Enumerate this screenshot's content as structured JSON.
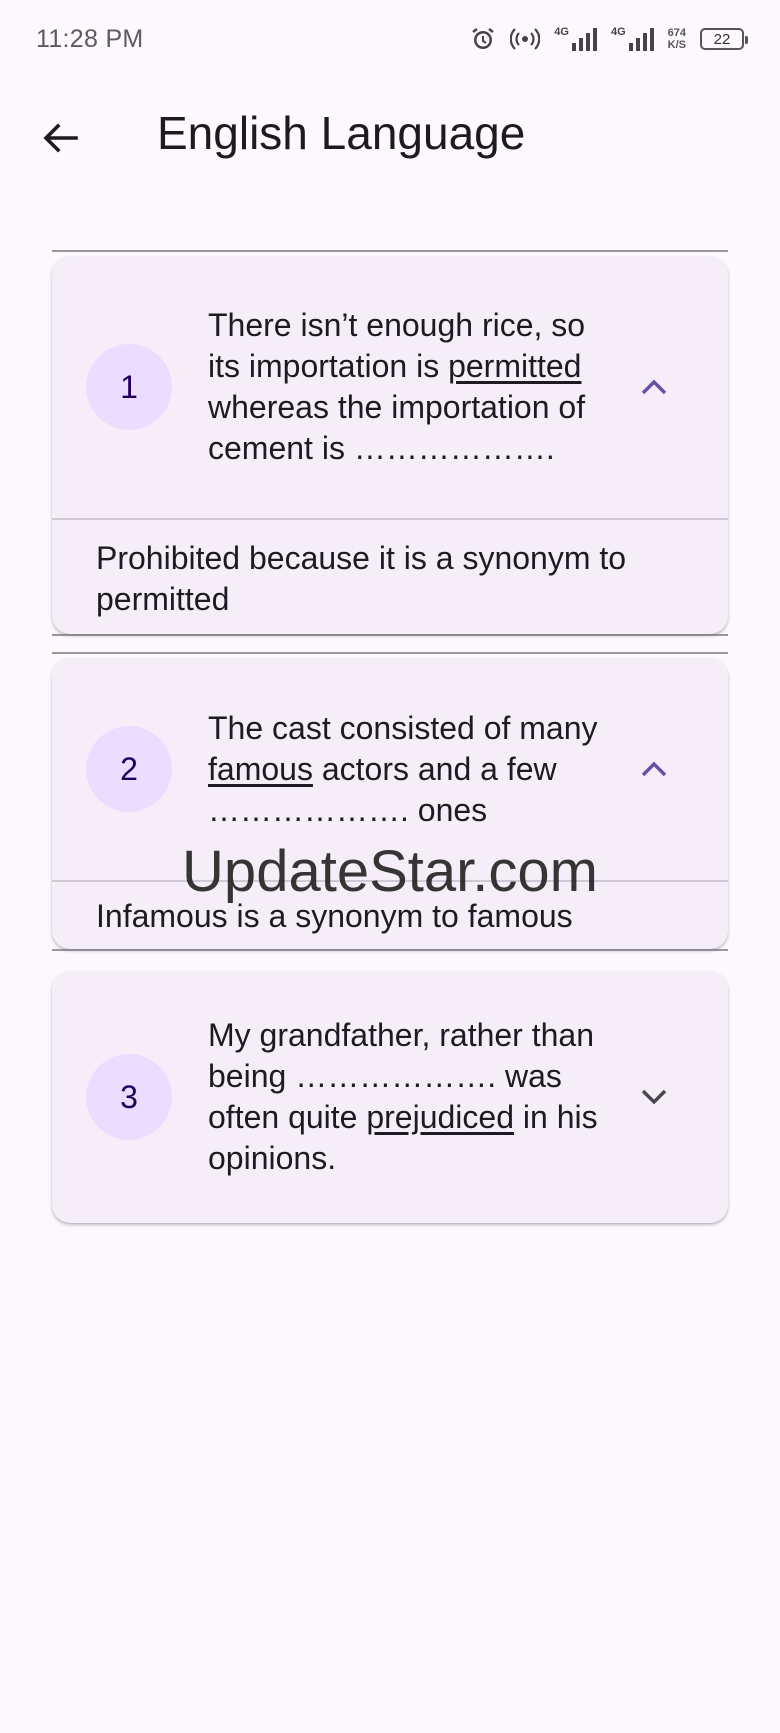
{
  "status": {
    "time": "11:28 PM",
    "net1": "4G",
    "net2": "4G",
    "speed_value": "674",
    "speed_unit": "K/S",
    "battery": "22"
  },
  "app_bar": {
    "title": "English Language",
    "back_icon": "arrow-back-icon"
  },
  "questions": [
    {
      "number": "1",
      "text_before": "There isn’t enough rice, so its importation is ",
      "underlined": "permitted",
      "text_after": " whereas the importation of cement is ……………….",
      "expanded": true,
      "answer": "Prohibited because it is a synonym to permitted"
    },
    {
      "number": "2",
      "text_before": "The cast consisted of many ",
      "underlined": "famous",
      "text_after": " actors and a few ………………. ones",
      "expanded": true,
      "answer": "Infamous is a synonym to famous"
    },
    {
      "number": "3",
      "text_before": "My grandfather, rather than being ………………. was often quite ",
      "underlined": "prejudiced",
      "text_after": " in his opinions.",
      "expanded": false,
      "answer": ""
    }
  ],
  "watermark": "UpdateStar.com",
  "colors": {
    "background": "#fdf8fd",
    "card": "#f5eef9",
    "badge": "#eaddff",
    "accent": "#6750a4"
  }
}
